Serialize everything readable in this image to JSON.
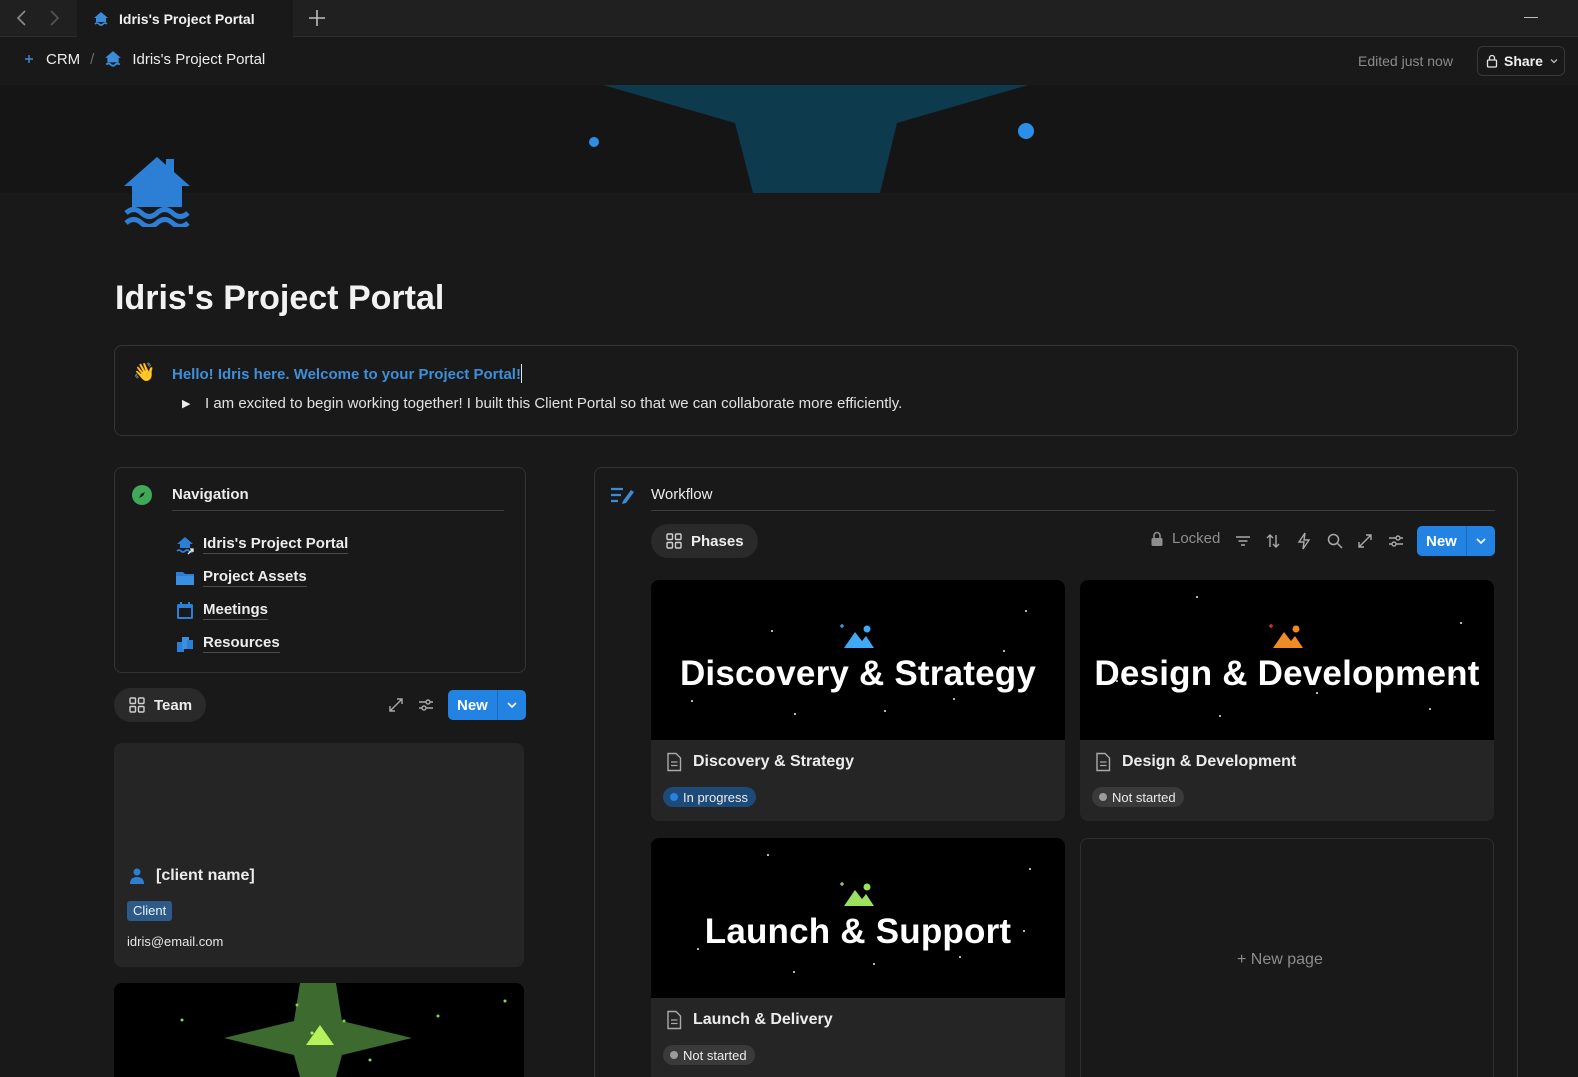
{
  "tabbar": {
    "tab_title": "Idris's Project Portal"
  },
  "breadcrumb": {
    "workspace": "CRM",
    "separator": "/",
    "page": "Idris's Project Portal",
    "edited": "Edited just now",
    "share_label": "Share"
  },
  "page": {
    "title": "Idris's Project Portal"
  },
  "callout": {
    "emoji": "👋",
    "heading": "Hello! Idris here. Welcome to your Project Portal!",
    "body": "I am excited to begin working together! I built this Client Portal so that we can collaborate more efficiently."
  },
  "navigation": {
    "title": "Navigation",
    "items": [
      {
        "label": "Idris's Project Portal",
        "icon": "house-flood-icon"
      },
      {
        "label": "Project Assets",
        "icon": "folder-icon"
      },
      {
        "label": "Meetings",
        "icon": "calendar-icon"
      },
      {
        "label": "Resources",
        "icon": "documents-icon"
      }
    ]
  },
  "team": {
    "view_label": "Team",
    "new_label": "New",
    "card": {
      "name": "[client name]",
      "badge": "Client",
      "email": "idris@email.com"
    }
  },
  "workflow": {
    "title": "Workflow",
    "view_label": "Phases",
    "locked_label": "Locked",
    "new_label": "New",
    "new_page_label": "New page",
    "cards": [
      {
        "cover_text": "Discovery & Strategy",
        "title": "Discovery & Strategy",
        "status": "In progress",
        "status_color": "#2383e2",
        "icon_color": "#3fa9f5"
      },
      {
        "cover_text": "Design & Development",
        "title": "Design & Development",
        "status": "Not started",
        "status_color": "#9b9b9b",
        "icon_color": "#f08a24"
      },
      {
        "cover_text": "Launch & Support",
        "title": "Launch & Delivery",
        "status": "Not started",
        "status_color": "#9b9b9b",
        "icon_color": "#9be15d"
      }
    ]
  },
  "colors": {
    "accent": "#2383e2",
    "background": "#191919",
    "callout_link": "#3e8ed8",
    "in_progress_badge": "#1d4a78",
    "not_started_badge": "#3a3a3a"
  }
}
